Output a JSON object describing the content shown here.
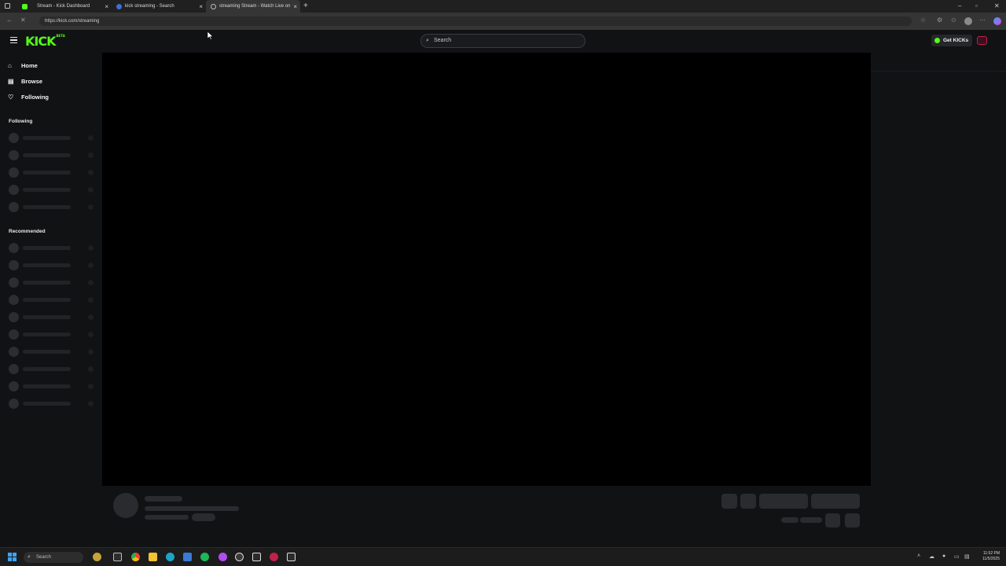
{
  "browser": {
    "tabs": [
      {
        "title": "Stream - Kick Dashboard",
        "active": false
      },
      {
        "title": "kick streaming - Search",
        "active": false
      },
      {
        "title": "streaming Stream - Watch Live on",
        "active": true
      }
    ],
    "url": "https://kick.com/streaming",
    "icons": [
      "back-icon",
      "refresh-icon",
      "star-icon",
      "extensions-icon",
      "profile-icon",
      "menu-icon"
    ]
  },
  "kick": {
    "logo": "KICK",
    "logo_tag": "BETA",
    "search_placeholder": "Search",
    "get_kicks_label": "Get KICKs",
    "nav": [
      {
        "label": "Home",
        "icon": "home-icon"
      },
      {
        "label": "Browse",
        "icon": "browse-icon"
      },
      {
        "label": "Following",
        "icon": "heart-icon"
      }
    ],
    "following_heading": "Following",
    "recommended_heading": "Recommended",
    "colors": {
      "brand": "#53fc18",
      "background": "#111214",
      "player": "#000000"
    }
  },
  "taskbar": {
    "search_placeholder": "Search",
    "time": "11:52 PM",
    "date": "11/5/2025"
  }
}
